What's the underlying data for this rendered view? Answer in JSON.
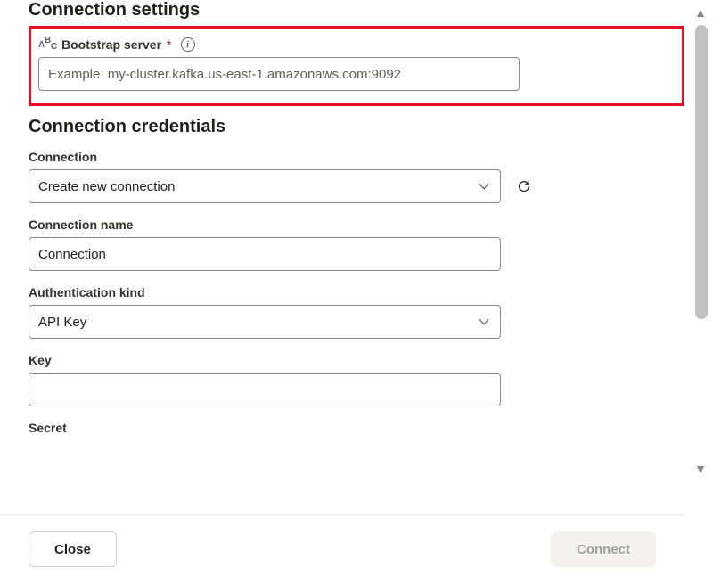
{
  "settings": {
    "heading": "Connection settings",
    "bootstrap_label": "Bootstrap server",
    "required_mark": "*",
    "bootstrap_placeholder": "Example: my-cluster.kafka.us-east-1.amazonaws.com:9092",
    "bootstrap_value": ""
  },
  "credentials": {
    "heading": "Connection credentials",
    "connection_label": "Connection",
    "connection_selected": "Create new connection",
    "connection_name_label": "Connection name",
    "connection_name_value": "Connection",
    "auth_kind_label": "Authentication kind",
    "auth_kind_selected": "API Key",
    "key_label": "Key",
    "key_value": "",
    "secret_label": "Secret"
  },
  "footer": {
    "close_label": "Close",
    "connect_label": "Connect"
  }
}
